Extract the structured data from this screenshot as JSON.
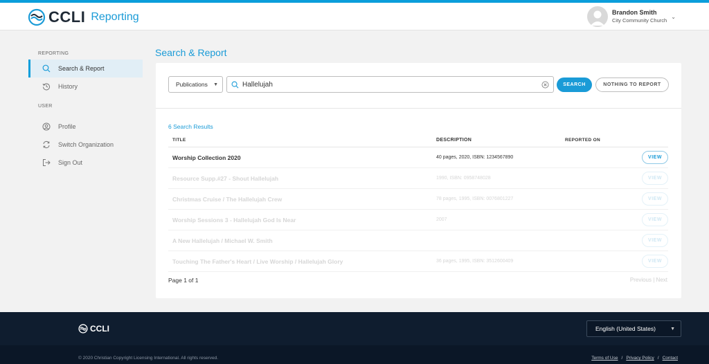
{
  "header": {
    "brand": "CCLI",
    "product": "Reporting",
    "user_name": "Brandon Smith",
    "user_org": "City Community Church",
    "accent": "#0b9edb"
  },
  "sidebar": {
    "section_reporting": "REPORTING",
    "section_user": "USER",
    "items": [
      {
        "label": "Search & Report",
        "icon": "search-icon",
        "active": true
      },
      {
        "label": "History",
        "icon": "history-icon"
      },
      {
        "label": "Profile",
        "icon": "profile-icon"
      },
      {
        "label": "Switch Organization",
        "icon": "switch-icon"
      },
      {
        "label": "Sign Out",
        "icon": "sign-out-icon"
      }
    ]
  },
  "main": {
    "title": "Search & Report",
    "filter_select": "Publications",
    "search_value": "Hallelujah",
    "search_button": "SEARCH",
    "nothing_button": "NOTHING TO REPORT",
    "results_count": "6 Search Results",
    "columns": {
      "title": "TITLE",
      "description": "DESCRIPTION",
      "reported_on": "REPORTED ON"
    },
    "view_label": "VIEW",
    "rows": [
      {
        "title": "Worship Collection 2020",
        "description": "40 pages, 2020, ISBN: 1234567890",
        "reported_on": ""
      },
      {
        "title": "Resource Supp.#27 - Shout Hallelujah",
        "description": "1990, ISBN: 0958748028",
        "reported_on": ""
      },
      {
        "title": "Christmas Cruise / The Hallelujah Crew",
        "description": "78 pages, 1995, ISBN: 0076801227",
        "reported_on": ""
      },
      {
        "title": "Worship Sessions 3 - Hallelujah God Is Near",
        "description": "2007",
        "reported_on": ""
      },
      {
        "title": "A New Hallelujah / Michael W. Smith",
        "description": "",
        "reported_on": ""
      },
      {
        "title": "Touching The Father's Heart / Live Worship / Hallelujah Glory",
        "description": "36 pages, 1995, ISBN: 3512600409",
        "reported_on": ""
      }
    ],
    "pager": "Page 1 of 1",
    "previous": "Previous",
    "separator": "|",
    "next": "Next"
  },
  "footer": {
    "brand": "CCLI",
    "language": "English (United States)",
    "copyright": "© 2020 Christian Copyright Licensing International. All rights reserved.",
    "links": [
      "Terms of Use",
      "Privacy Policy",
      "Contact"
    ],
    "link_sep": "/"
  }
}
